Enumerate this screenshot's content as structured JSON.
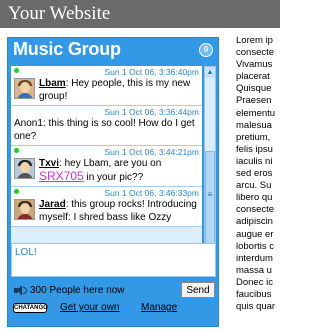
{
  "site": {
    "title": "Your Website"
  },
  "widget": {
    "title": "Music Group",
    "unread_count": "0",
    "messages": [
      {
        "timestamp": "Sun 1 Oct 06, 3:36:40pm",
        "user": "Lbam",
        "separator": ":",
        "text": "Hey people, this is my new group!"
      },
      {
        "timestamp": "Sun 1 Oct 06, 3:36:44pm",
        "user": "",
        "separator": "",
        "text": "Anon1: this thing is so cool! How do I get one?"
      },
      {
        "timestamp": "Sun 1 Oct 06, 3:44:21pm",
        "user": "Txvi",
        "separator": ":",
        "text": "hey Lbam, are you on",
        "link": "SRX705",
        "text_after": " in your pic??"
      },
      {
        "timestamp": "Sun 1 Oct 06, 3:46:33pm",
        "user": "Jarad",
        "separator": ":",
        "text": "this group rocks! Introducing myself: I shred bass like Ozzy"
      }
    ],
    "input": {
      "value": "LOL!"
    },
    "footer": {
      "people_count": "300 People here now",
      "send_label": "Send",
      "brand": "CHATANGO",
      "get_your_own": "Get your own",
      "manage": "Manage"
    }
  },
  "lorem_text": "Lorem ip\nconsecte\nVivamus\nplacerat\nQuisque\nPraesen\nelementu\nmalesua\npretium,\nfelis ipsu\niaculis ni\nsed eros\narcu. Su\nlibero qu\nconsecte\nadipiscin\naugue er\nlobortis c\ninterdum\nmassa u\nDonec ic\nfaucibus\nquis quar",
  "colors": {
    "widget_bg": "#3399e6",
    "topbar_bg": "#6a6a6a",
    "timestamp": "#2a86cf",
    "link_magenta": "#cc33cc",
    "online_dot": "#22cc22"
  }
}
